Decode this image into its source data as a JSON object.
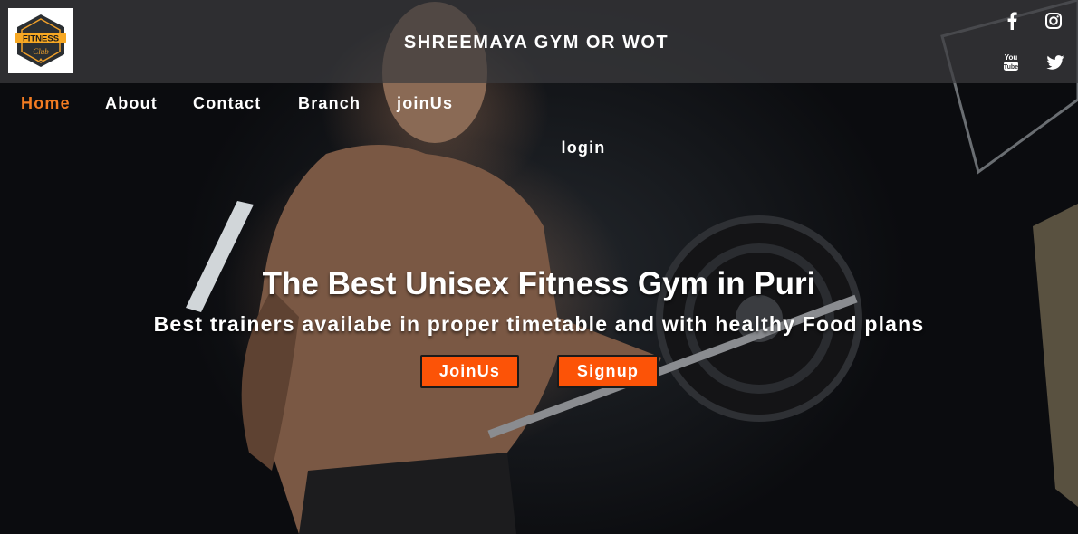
{
  "brand": {
    "logo_text_line1": "FITNESS",
    "logo_text_line2": "Club",
    "site_title": "SHREEMAYA GYM OR WOT"
  },
  "social": [
    {
      "name": "facebook-icon"
    },
    {
      "name": "instagram-icon"
    },
    {
      "name": "youtube-icon"
    },
    {
      "name": "twitter-icon"
    }
  ],
  "nav": {
    "items": [
      {
        "label": "Home",
        "active": true
      },
      {
        "label": "About",
        "active": false
      },
      {
        "label": "Contact",
        "active": false
      },
      {
        "label": "Branch",
        "active": false
      },
      {
        "label": "joinUs",
        "active": false
      }
    ],
    "login": "login"
  },
  "hero": {
    "headline": "The Best Unisex Fitness Gym in Puri",
    "subline": "Best trainers availabe in proper timetable and with healthy Food plans",
    "buttons": {
      "join_label": "JoinUs",
      "signup_label": "Signup"
    }
  },
  "colors": {
    "accent": "#f37c22",
    "button": "#fc5307",
    "header_overlay": "#3c3c3e"
  }
}
